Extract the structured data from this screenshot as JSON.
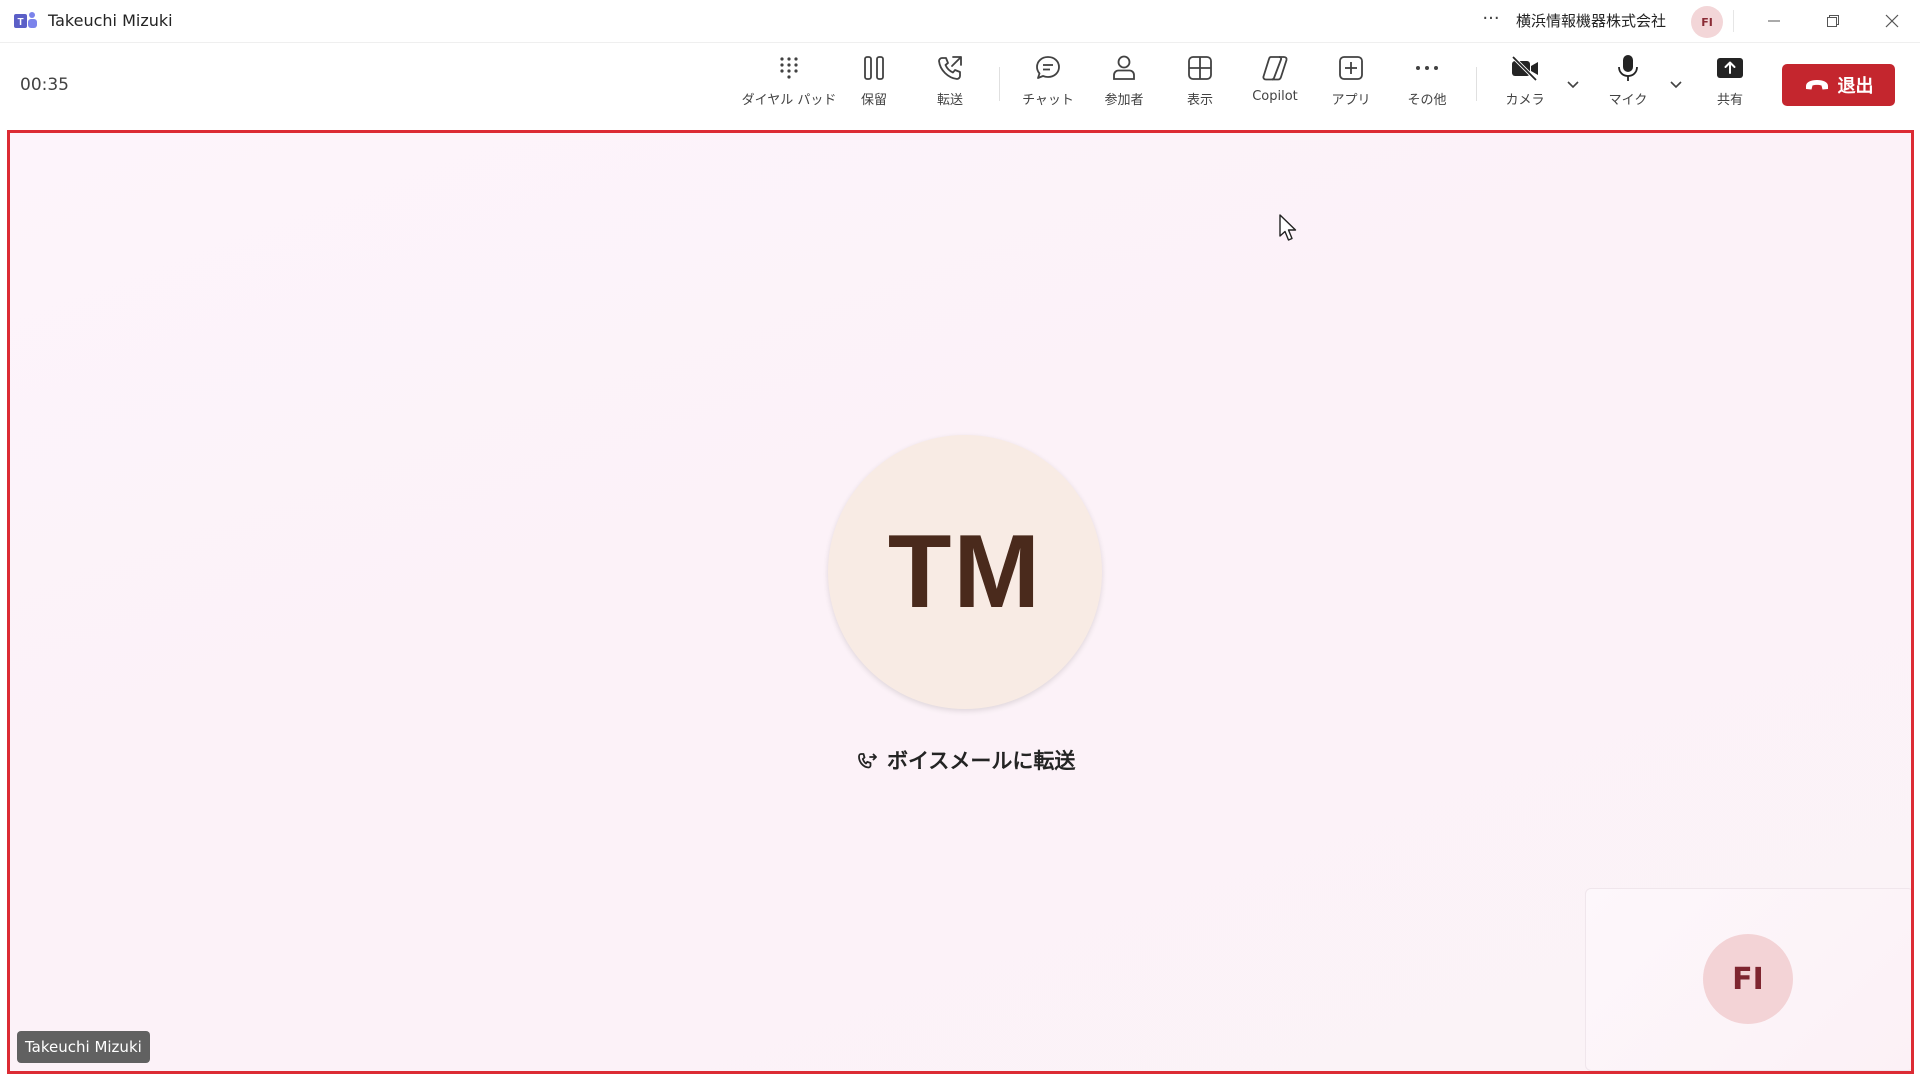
{
  "window": {
    "title": "Takeuchi Mizuki",
    "org_name": "横浜情報機器株式会社",
    "user_initials": "FI",
    "more_label": "···"
  },
  "toolbar": {
    "timer": "00:35",
    "buttons": [
      {
        "id": "dialpad",
        "label": "ダイヤル パッド",
        "icon": "dialpad-icon"
      },
      {
        "id": "hold",
        "label": "保留",
        "icon": "pause-icon"
      },
      {
        "id": "transfer",
        "label": "転送",
        "icon": "phone-transfer-icon"
      },
      {
        "id": "chat",
        "label": "チャット",
        "icon": "chat-icon"
      },
      {
        "id": "people",
        "label": "参加者",
        "icon": "person-icon"
      },
      {
        "id": "view",
        "label": "表示",
        "icon": "grid-icon"
      },
      {
        "id": "copilot",
        "label": "Copilot",
        "icon": "copilot-icon"
      },
      {
        "id": "apps",
        "label": "アプリ",
        "icon": "add-app-icon"
      },
      {
        "id": "more",
        "label": "その他",
        "icon": "more-icon"
      },
      {
        "id": "camera",
        "label": "カメラ",
        "icon": "camera-off-icon"
      },
      {
        "id": "mic",
        "label": "マイク",
        "icon": "microphone-icon"
      },
      {
        "id": "share",
        "label": "共有",
        "icon": "share-screen-icon"
      }
    ],
    "leave_label": "退出"
  },
  "stage": {
    "participant_initials": "TM",
    "status": "ボイスメールに転送",
    "participant_name": "Takeuchi Mizuki",
    "self_initials": "FI"
  },
  "colors": {
    "leave": "#c4262e",
    "stage_border": "#dc2b34",
    "teams_purple": "#5b5fc7"
  }
}
